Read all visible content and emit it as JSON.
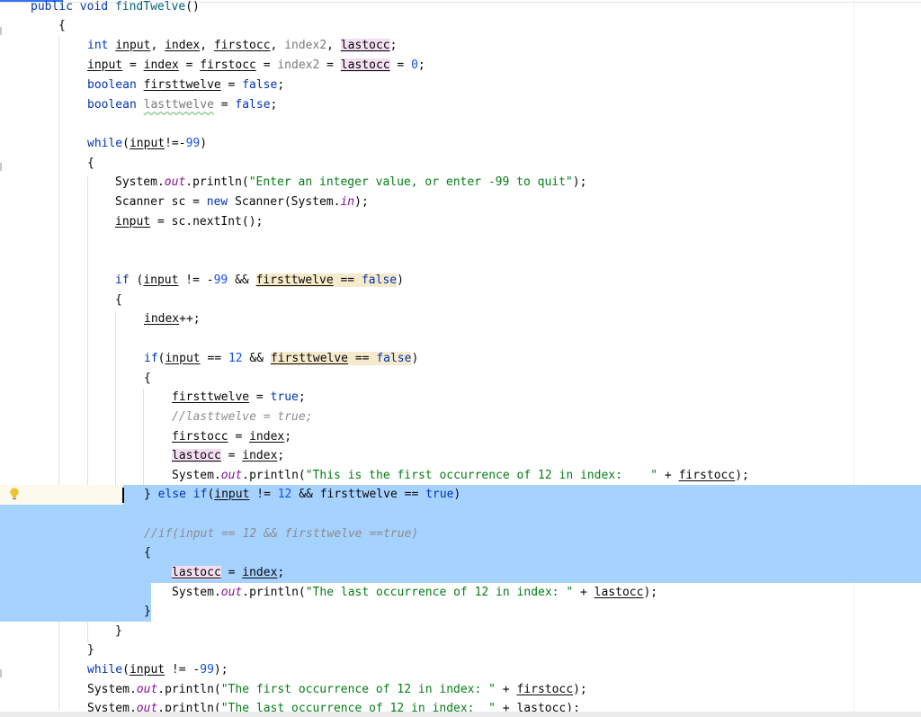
{
  "editor": {
    "lines": {
      "l1": [
        "public",
        " void ",
        "findTwelve",
        "()"
      ],
      "l2": [
        "{"
      ],
      "l3": [
        "int ",
        "input",
        ", ",
        "index",
        ", ",
        "firstocc",
        ", ",
        "index2",
        ", ",
        "lastocc",
        ";"
      ],
      "l4": [
        "input",
        " = ",
        "index",
        " = ",
        "firstocc",
        " = ",
        "index2",
        " = ",
        "lastocc",
        " = ",
        "0",
        ";"
      ],
      "l5": [
        "boolean ",
        "firsttwelve",
        " = ",
        "false",
        ";"
      ],
      "l6": [
        "boolean ",
        "lasttwelve",
        " = ",
        "false",
        ";"
      ],
      "l7": [
        "while",
        "(",
        "input",
        "!=-",
        "99",
        ")"
      ],
      "l8": [
        "{"
      ],
      "l9": [
        "System.",
        "out",
        ".println(",
        "\"Enter an integer value, or enter -99 to quit\"",
        ");"
      ],
      "l10": [
        "Scanner sc = ",
        "new ",
        "Scanner(System.",
        "in",
        ");"
      ],
      "l11": [
        "input",
        " = sc.nextInt();"
      ],
      "l12": [
        "if ",
        "(",
        "input",
        " != -",
        "99",
        " && ",
        "firsttwelve",
        " == ",
        "false",
        ")"
      ],
      "l13": [
        "{"
      ],
      "l14": [
        "index",
        "++;"
      ],
      "l15": [
        "if",
        "(",
        "input",
        " == ",
        "12",
        " && ",
        "firsttwelve",
        " == ",
        "false",
        ")"
      ],
      "l16": [
        "{"
      ],
      "l17": [
        "firsttwelve",
        " = ",
        "true",
        ";"
      ],
      "l18": [
        "//lasttwelve = true;"
      ],
      "l19": [
        "firstocc",
        " = ",
        "index",
        ";"
      ],
      "l20": [
        "lastocc",
        " = ",
        "index",
        ";"
      ],
      "l21": [
        "System.",
        "out",
        ".println(",
        "\"This is the first occurrence of 12 in index:    \"",
        " + ",
        "firstocc",
        ");"
      ],
      "l22": [
        "} ",
        "else if",
        "(",
        "input",
        " != ",
        "12",
        " && firsttwelve == ",
        "true",
        ")"
      ],
      "l23": [
        "//if(input == 12 && firsttwelve ==true)"
      ],
      "l24": [
        "{"
      ],
      "l25": [
        "lastocc",
        " = ",
        "index",
        ";"
      ],
      "l26": [
        "System.",
        "out",
        ".println(",
        "\"The last occurrence of 12 in index: \"",
        " + ",
        "lastocc",
        ");"
      ],
      "l27": [
        "}"
      ],
      "l28": [
        "}"
      ],
      "l29": [
        "}"
      ],
      "l30": [
        "while",
        "(",
        "input",
        " != -",
        "99",
        ");"
      ],
      "l31": [
        "System.",
        "out",
        ".println(",
        "\"The first occurrence of 12 in index: \"",
        " + ",
        "firstocc",
        ");"
      ],
      "l32": [
        "System.",
        "out",
        ".println(",
        "\"The last occurrence of 12 in index:  \"",
        " + ",
        "lastocc",
        ");"
      ]
    },
    "icons": {
      "intention": "lightbulb-icon"
    },
    "colors": {
      "keyword": "#0033b3",
      "number": "#1750eb",
      "string": "#067d17",
      "field": "#871094",
      "comment": "#8c8c8c",
      "selection": "#a6d2ff",
      "caret_line": "#fcfaed",
      "write_highlight": "#f5eacb",
      "read_highlight": "#f3def2"
    }
  }
}
